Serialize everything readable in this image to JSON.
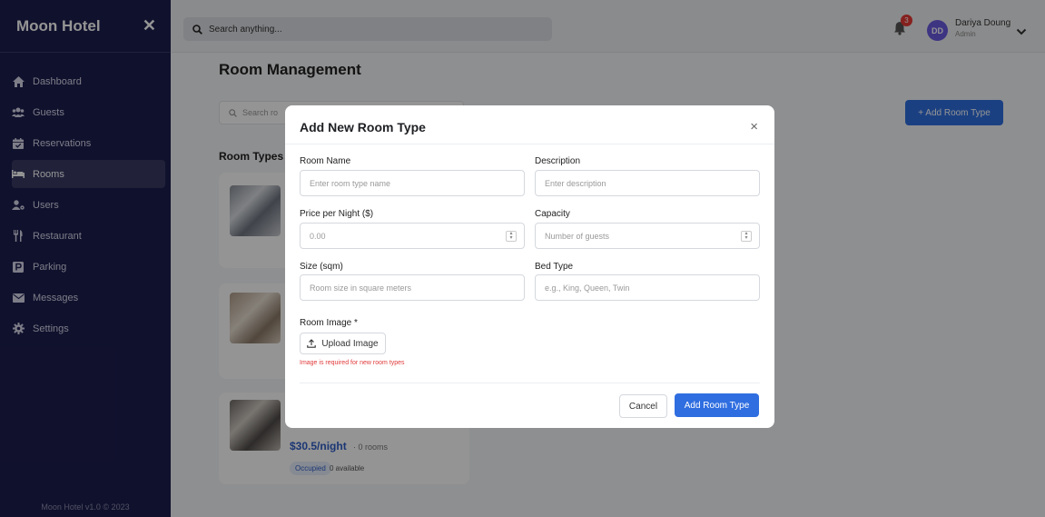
{
  "sidebar": {
    "brand": "Moon Hotel",
    "items": [
      {
        "label": "Dashboard",
        "icon": "home-icon"
      },
      {
        "label": "Guests",
        "icon": "users-icon"
      },
      {
        "label": "Reservations",
        "icon": "calendar-check-icon"
      },
      {
        "label": "Rooms",
        "icon": "bed-icon",
        "active": true
      },
      {
        "label": "Users",
        "icon": "user-cog-icon"
      },
      {
        "label": "Restaurant",
        "icon": "utensils-icon"
      },
      {
        "label": "Parking",
        "icon": "parking-icon"
      },
      {
        "label": "Messages",
        "icon": "envelope-icon"
      },
      {
        "label": "Settings",
        "icon": "gear-icon"
      }
    ],
    "footer": "Moon Hotel v1.0 © 2023"
  },
  "topbar": {
    "search_placeholder": "Search anything...",
    "notification_count": "3",
    "user_initials": "DD",
    "user_name": "Dariya Doung",
    "user_role": "Admin"
  },
  "main": {
    "title": "Room Management",
    "search_placeholder": "Search ro",
    "add_button": "+ Add Room Type",
    "section_title": "Room Types",
    "cards": [
      {
        "price": "$30.5/night",
        "rooms": "· 0 rooms",
        "status": "Occupied",
        "available": "0 available"
      }
    ]
  },
  "modal": {
    "title": "Add New Room Type",
    "close": "×",
    "fields": {
      "room_name": {
        "label": "Room Name",
        "placeholder": "Enter room type name"
      },
      "description": {
        "label": "Description",
        "placeholder": "Enter description"
      },
      "price": {
        "label": "Price per Night ($)",
        "placeholder": "0.00"
      },
      "capacity": {
        "label": "Capacity",
        "placeholder": "Number of guests"
      },
      "size": {
        "label": "Size (sqm)",
        "placeholder": "Room size in square meters"
      },
      "bed_type": {
        "label": "Bed Type",
        "placeholder": "e.g., King, Queen, Twin"
      }
    },
    "image_label": "Room Image *",
    "upload_label": "Upload Image",
    "error": "Image is required for new room types",
    "cancel": "Cancel",
    "submit": "Add Room Type"
  },
  "colors": {
    "sidebar_bg": "#1d1e4f",
    "accent": "#2f6ee0",
    "error": "#e03a3a"
  }
}
